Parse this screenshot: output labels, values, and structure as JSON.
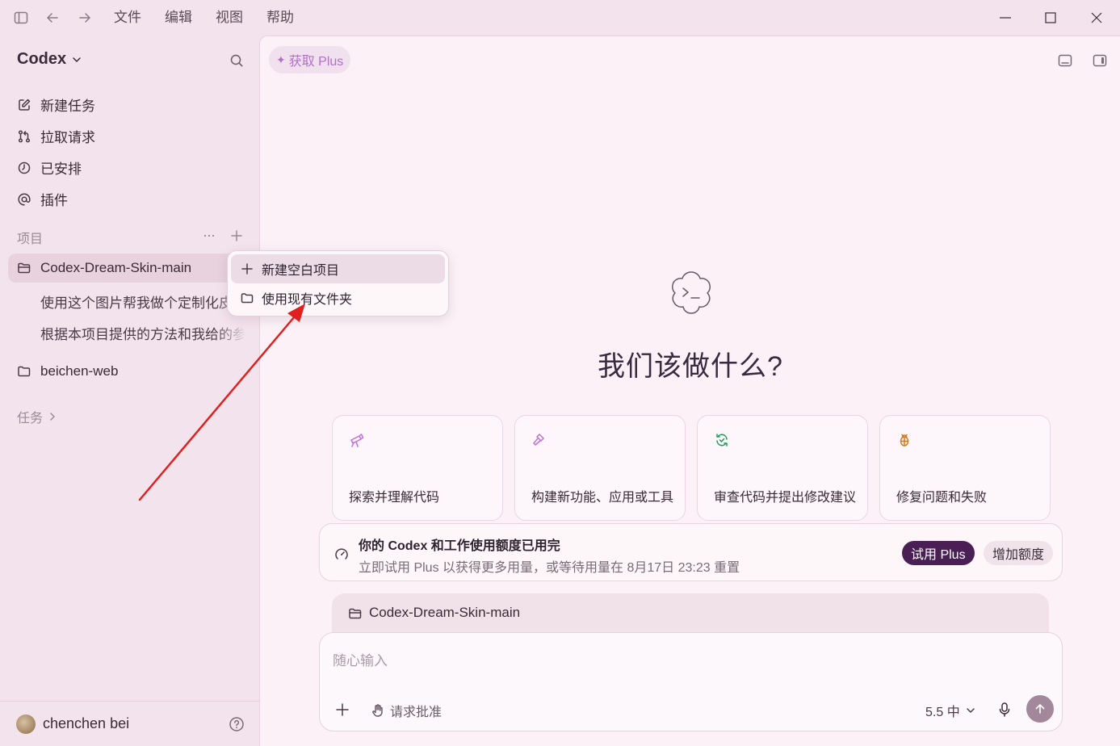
{
  "menubar": {
    "items": [
      "文件",
      "编辑",
      "视图",
      "帮助"
    ]
  },
  "sidebar": {
    "brand": "Codex",
    "nav": [
      {
        "label": "新建任务",
        "icon": "edit-icon"
      },
      {
        "label": "拉取请求",
        "icon": "pull-request-icon"
      },
      {
        "label": "已安排",
        "icon": "clock-icon"
      },
      {
        "label": "插件",
        "icon": "at-icon"
      }
    ],
    "projects_label": "项目",
    "projects": [
      {
        "name": "Codex-Dream-Skin-main",
        "threads": [
          "使用这个图片帮我做个定制化皮肤",
          "根据本项目提供的方法和我给的参考"
        ]
      },
      {
        "name": "beichen-web",
        "threads": []
      }
    ],
    "tasks_label": "任务",
    "user": {
      "name": "chenchen bei"
    }
  },
  "context_menu": {
    "items": [
      {
        "label": "新建空白项目",
        "icon": "plus-icon"
      },
      {
        "label": "使用现有文件夹",
        "icon": "folder-icon"
      }
    ]
  },
  "main": {
    "get_plus": "获取 Plus",
    "hero_title": "我们该做什么?",
    "cards": [
      {
        "label": "探索并理解代码",
        "icon": "telescope-icon",
        "color": "#c070d8"
      },
      {
        "label": "构建新功能、应用或工具",
        "icon": "hammer-icon",
        "color": "#c070d8"
      },
      {
        "label": "审查代码并提出修改建议",
        "icon": "refresh-check-icon",
        "color": "#1f9a5a"
      },
      {
        "label": "修复问题和失败",
        "icon": "bug-icon",
        "color": "#d07a20"
      }
    ],
    "quota": {
      "title": "你的 Codex 和工作使用额度已用完",
      "subtitle": "立即试用 Plus 以获得更多用量，或等待用量在 8月17日 23:23 重置",
      "try_plus": "试用 Plus",
      "add_quota": "增加额度"
    },
    "project_tab": "Codex-Dream-Skin-main",
    "composer": {
      "placeholder": "随心输入",
      "approval": "请求批准",
      "model": "5.5 中"
    }
  },
  "colors": {
    "accent": "#4a1f55",
    "sidebar_bg": "#f3e3ec",
    "main_bg": "#fbf1f6",
    "annotation_arrow": "#e02020"
  }
}
